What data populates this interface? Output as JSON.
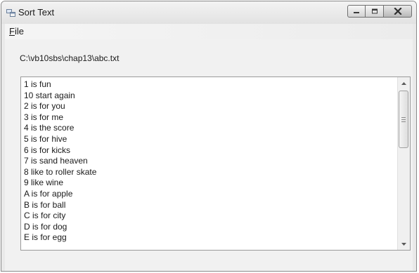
{
  "window": {
    "title": "Sort Text",
    "icon": "app-window-icon",
    "controls": [
      "minimize-icon",
      "maximize-icon",
      "close-icon"
    ]
  },
  "menu": {
    "file_accel": "F",
    "file_rest": "ile"
  },
  "path_label": "C:\\vb10sbs\\chap13\\abc.txt",
  "textbox": {
    "lines": [
      "1 is fun",
      "10 start again",
      "2 is for you",
      "3 is for me",
      "4 is the score",
      "5 is for hive",
      "6 is for kicks",
      "7 is sand heaven",
      "8 like to roller skate",
      "9 like wine",
      "A is for apple",
      "B is for ball",
      "C is for city",
      "D is for dog",
      "E is for egg"
    ]
  }
}
